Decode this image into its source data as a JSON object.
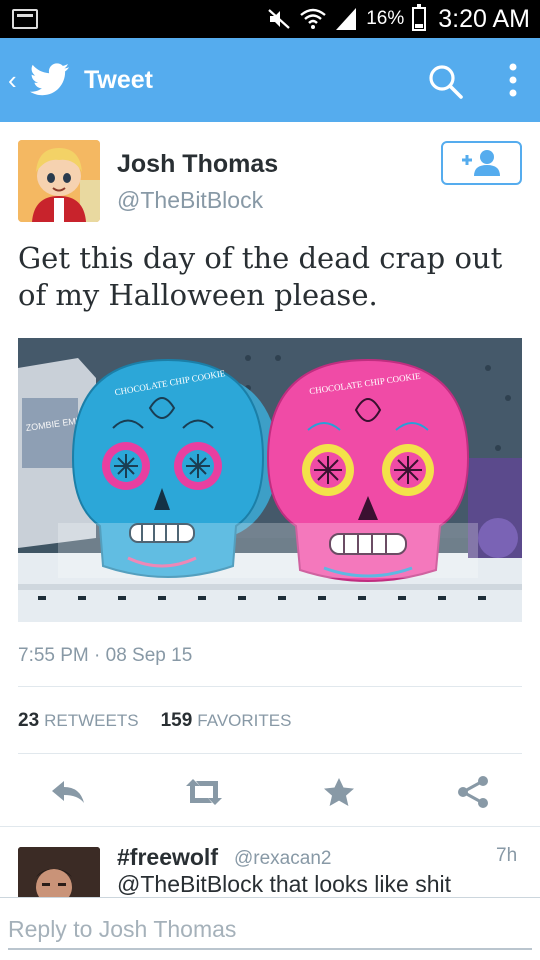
{
  "status_bar": {
    "battery_pct": "16%",
    "time": "3:20 AM",
    "icons": [
      "notification-icon",
      "mute-icon",
      "wifi-icon",
      "signal-icon",
      "battery-icon"
    ]
  },
  "app_bar": {
    "title": "Tweet",
    "icons": [
      "back-chevron-icon",
      "twitter-bird-icon",
      "search-icon",
      "more-vert-icon"
    ],
    "color": "#55acee"
  },
  "tweet": {
    "user_name": "Josh Thomas",
    "user_handle": "@TheBitBlock",
    "follow_icon": "add-user-icon",
    "text": "Get this day of the dead crap out of my Halloween please.",
    "photo_text": {
      "left_skull_label": "CHOCOLATE CHIP COOKIE",
      "right_skull_label": "CHOCOLATE CHIP COOKIE",
      "side_box_label": "ZOMBIE EMPORIUM"
    },
    "timestamp": "7:55 PM · 08 Sep 15",
    "retweets_count": "23",
    "retweets_label": "RETWEETS",
    "favorites_count": "159",
    "favorites_label": "FAVORITES"
  },
  "actions": [
    "reply-icon",
    "retweet-icon",
    "favorite-icon",
    "share-icon"
  ],
  "reply": {
    "name": "#freewolf",
    "handle": "@rexacan2",
    "time": "7h",
    "text": "@TheBitBlock that looks like shit"
  },
  "composer": {
    "placeholder": "Reply to Josh Thomas"
  }
}
